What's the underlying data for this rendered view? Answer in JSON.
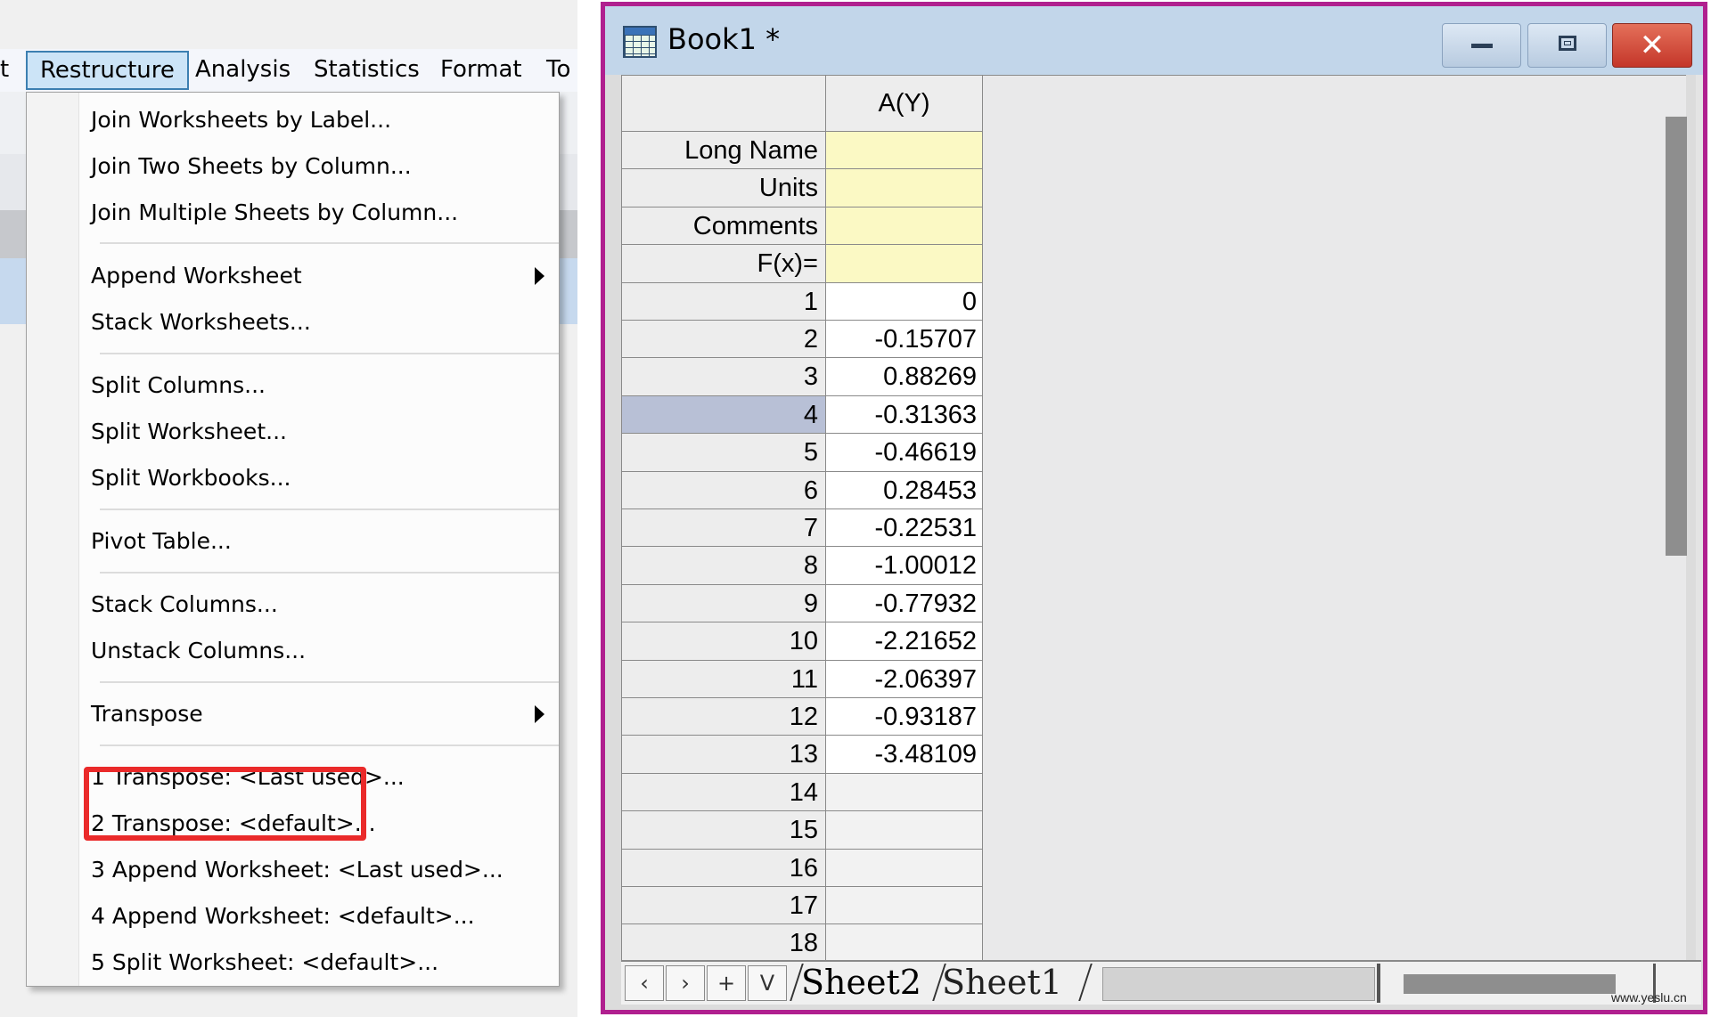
{
  "menubar": {
    "items": [
      {
        "label": "t"
      },
      {
        "label": "Restructure"
      },
      {
        "label": "Analysis"
      },
      {
        "label": "Statistics"
      },
      {
        "label": "Format"
      },
      {
        "label": "To"
      }
    ]
  },
  "menu": {
    "items": [
      {
        "label": "Join Worksheets by Label..."
      },
      {
        "label": "Join Two Sheets by Column..."
      },
      {
        "label": "Join Multiple Sheets by Column..."
      },
      {
        "label": "Append Worksheet",
        "submenu": true
      },
      {
        "label": "Stack Worksheets..."
      },
      {
        "label": "Split Columns..."
      },
      {
        "label": "Split Worksheet..."
      },
      {
        "label": "Split Workbooks..."
      },
      {
        "label": "Pivot Table..."
      },
      {
        "label": "Stack Columns..."
      },
      {
        "label": "Unstack Columns..."
      },
      {
        "label": "Transpose",
        "submenu": true,
        "highlighted": true
      },
      {
        "label": "1 Transpose: <Last used>..."
      },
      {
        "label": "2 Transpose: <default>..."
      },
      {
        "label": "3 Append Worksheet: <Last used>..."
      },
      {
        "label": "4 Append Worksheet: <default>..."
      },
      {
        "label": "5 Split Worksheet: <default>..."
      }
    ],
    "highlight_color": "#ea2a2a"
  },
  "book": {
    "title": "Book1 *",
    "close_glyph": "✕",
    "column_header": "A(Y)",
    "label_rows": [
      {
        "label": "Long Name",
        "value": ""
      },
      {
        "label": "Units",
        "value": ""
      },
      {
        "label": "Comments",
        "value": ""
      },
      {
        "label": "F(x)=",
        "value": ""
      }
    ],
    "rows": [
      {
        "n": "1",
        "value": "0"
      },
      {
        "n": "2",
        "value": "-0.15707"
      },
      {
        "n": "3",
        "value": "0.88269"
      },
      {
        "n": "4",
        "value": "-0.31363",
        "selected": true
      },
      {
        "n": "5",
        "value": "-0.46619"
      },
      {
        "n": "6",
        "value": "0.28453"
      },
      {
        "n": "7",
        "value": "-0.22531"
      },
      {
        "n": "8",
        "value": "-1.00012"
      },
      {
        "n": "9",
        "value": "-0.77932"
      },
      {
        "n": "10",
        "value": "-2.21652"
      },
      {
        "n": "11",
        "value": "-2.06397"
      },
      {
        "n": "12",
        "value": "-0.93187"
      },
      {
        "n": "13",
        "value": "-3.48109"
      },
      {
        "n": "14",
        "value": ""
      },
      {
        "n": "15",
        "value": ""
      },
      {
        "n": "16",
        "value": ""
      },
      {
        "n": "17",
        "value": ""
      },
      {
        "n": "18",
        "value": ""
      }
    ],
    "nav": {
      "prev": "‹",
      "next": "›",
      "add": "+",
      "list": "V"
    },
    "tabs": [
      {
        "label": "Sheet2",
        "active": true
      },
      {
        "label": "Sheet1"
      }
    ],
    "window_border_color": "#b0208f",
    "label_cell_color": "#fbf9c4"
  },
  "watermark": "www.yeslu.cn"
}
